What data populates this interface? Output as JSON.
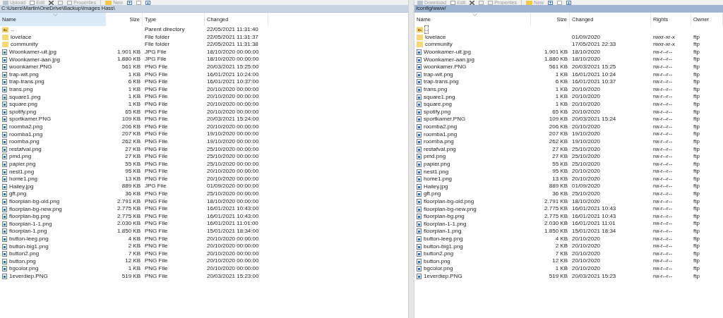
{
  "panes": [
    {
      "toolbar": [
        {
          "kind": "transfer",
          "label": "Upload"
        },
        {
          "kind": "edit",
          "label": "Edit"
        },
        {
          "kind": "delete"
        },
        {
          "kind": "rename"
        },
        {
          "kind": "properties",
          "label": "Properties"
        },
        {
          "kind": "new",
          "label": "New"
        },
        {
          "kind": "up"
        },
        {
          "kind": "blank"
        },
        {
          "kind": "down"
        }
      ],
      "active": false,
      "path": "C:\\Users\\Martin\\OneDrive\\Backup\\Images Hass\\",
      "columns": [
        {
          "label": "Name",
          "sorted": true,
          "highlighted": true
        },
        {
          "label": "Size",
          "sorted": false,
          "highlighted": false
        },
        {
          "label": "Type",
          "sorted": false,
          "highlighted": false
        },
        {
          "label": "Changed",
          "sorted": false,
          "highlighted": false
        }
      ],
      "rows": [
        {
          "kind": "parent",
          "focused": false,
          "cells": [
            "..",
            "",
            "Parent directory",
            "22/05/2021  11:31:40"
          ]
        },
        {
          "kind": "folder",
          "focused": false,
          "cells": [
            "lovelace",
            "",
            "File folder",
            "22/05/2021  11:31:37"
          ]
        },
        {
          "kind": "folder",
          "focused": false,
          "cells": [
            "community",
            "",
            "File folder",
            "22/05/2021  11:31:38"
          ]
        },
        {
          "kind": "file",
          "focused": false,
          "cells": [
            "Woonkamer-uit.jpg",
            "1.901 KB",
            "JPG File",
            "18/10/2020  00:00:00"
          ]
        },
        {
          "kind": "file",
          "focused": false,
          "cells": [
            "Woonkamer-aan.jpg",
            "1.880 KB",
            "JPG File",
            "18/10/2020  00:00:00"
          ]
        },
        {
          "kind": "file",
          "focused": false,
          "cells": [
            "woonkamer.PNG",
            "561 KB",
            "PNG File",
            "20/03/2021  15:25:00"
          ]
        },
        {
          "kind": "file",
          "focused": false,
          "cells": [
            "trap-wit.png",
            "1 KB",
            "PNG File",
            "16/01/2021  10:24:00"
          ]
        },
        {
          "kind": "file",
          "focused": false,
          "cells": [
            "trap-trans.png",
            "6 KB",
            "PNG File",
            "16/01/2021  10:37:00"
          ]
        },
        {
          "kind": "file",
          "focused": false,
          "cells": [
            "trans.png",
            "1 KB",
            "PNG File",
            "20/10/2020  00:00:00"
          ]
        },
        {
          "kind": "file",
          "focused": false,
          "cells": [
            "square1.png",
            "1 KB",
            "PNG File",
            "20/10/2020  00:00:00"
          ]
        },
        {
          "kind": "file",
          "focused": false,
          "cells": [
            "square.png",
            "1 KB",
            "PNG File",
            "20/10/2020  00:00:00"
          ]
        },
        {
          "kind": "file",
          "focused": false,
          "cells": [
            "spotify.png",
            "65 KB",
            "PNG File",
            "20/10/2020  00:00:00"
          ]
        },
        {
          "kind": "file",
          "focused": false,
          "cells": [
            "sportkamer.PNG",
            "109 KB",
            "PNG File",
            "20/03/2021  15:24:00"
          ]
        },
        {
          "kind": "file",
          "focused": false,
          "cells": [
            "roomba2.png",
            "206 KB",
            "PNG File",
            "20/10/2020  00:00:00"
          ]
        },
        {
          "kind": "file",
          "focused": false,
          "cells": [
            "roomba1.png",
            "207 KB",
            "PNG File",
            "19/10/2020  00:00:00"
          ]
        },
        {
          "kind": "file",
          "focused": false,
          "cells": [
            "roomba.png",
            "262 KB",
            "PNG File",
            "19/10/2020  00:00:00"
          ]
        },
        {
          "kind": "file",
          "focused": false,
          "cells": [
            "restafval.png",
            "27 KB",
            "PNG File",
            "25/10/2020  00:00:00"
          ]
        },
        {
          "kind": "file",
          "focused": false,
          "cells": [
            "pmd.png",
            "27 KB",
            "PNG File",
            "25/10/2020  00:00:00"
          ]
        },
        {
          "kind": "file",
          "focused": false,
          "cells": [
            "papier.png",
            "55 KB",
            "PNG File",
            "25/10/2020  00:00:00"
          ]
        },
        {
          "kind": "file",
          "focused": false,
          "cells": [
            "nest1.png",
            "95 KB",
            "PNG File",
            "20/10/2020  00:00:00"
          ]
        },
        {
          "kind": "file",
          "focused": false,
          "cells": [
            "home1.png",
            "13 KB",
            "PNG File",
            "20/10/2020  00:00:00"
          ]
        },
        {
          "kind": "file",
          "focused": false,
          "cells": [
            "Hailey.jpg",
            "889 KB",
            "JPG File",
            "01/09/2020  00:00:00"
          ]
        },
        {
          "kind": "file",
          "focused": false,
          "cells": [
            "gft.png",
            "36 KB",
            "PNG File",
            "25/10/2020  00:00:00"
          ]
        },
        {
          "kind": "file",
          "focused": false,
          "cells": [
            "floorplan-bg-old.png",
            "2.791 KB",
            "PNG File",
            "18/10/2020  00:00:00"
          ]
        },
        {
          "kind": "file",
          "focused": false,
          "cells": [
            "floorplan-bg-new.png",
            "2.775 KB",
            "PNG File",
            "16/01/2021  10:43:00"
          ]
        },
        {
          "kind": "file",
          "focused": false,
          "cells": [
            "floorplan-bg.png",
            "2.775 KB",
            "PNG File",
            "16/01/2021  10:43:00"
          ]
        },
        {
          "kind": "file",
          "focused": false,
          "cells": [
            "floorplan-1-1.png",
            "2.030 KB",
            "PNG File",
            "16/01/2021  11:01:00"
          ]
        },
        {
          "kind": "file",
          "focused": false,
          "cells": [
            "floorplan-1.png",
            "1.850 KB",
            "PNG File",
            "15/01/2021  18:34:00"
          ]
        },
        {
          "kind": "file",
          "focused": false,
          "cells": [
            "button-leeg.png",
            "4 KB",
            "PNG File",
            "20/10/2020  00:00:00"
          ]
        },
        {
          "kind": "file",
          "focused": false,
          "cells": [
            "button-big1.png",
            "2 KB",
            "PNG File",
            "20/10/2020  00:00:00"
          ]
        },
        {
          "kind": "file",
          "focused": false,
          "cells": [
            "button2.png",
            "7 KB",
            "PNG File",
            "20/10/2020  00:00:00"
          ]
        },
        {
          "kind": "file",
          "focused": false,
          "cells": [
            "button.png",
            "12 KB",
            "PNG File",
            "20/10/2020  00:00:00"
          ]
        },
        {
          "kind": "file",
          "focused": false,
          "cells": [
            "bgcolor.png",
            "1 KB",
            "PNG File",
            "20/10/2020  00:00:00"
          ]
        },
        {
          "kind": "file",
          "focused": false,
          "cells": [
            "1everdiep.PNG",
            "519 KB",
            "PNG File",
            "20/03/2021  15:23:00"
          ]
        }
      ]
    },
    {
      "toolbar": [
        {
          "kind": "transfer",
          "label": "Download"
        },
        {
          "kind": "edit",
          "label": "Edit"
        },
        {
          "kind": "delete"
        },
        {
          "kind": "rename"
        },
        {
          "kind": "properties",
          "label": "Properties"
        },
        {
          "kind": "new",
          "label": "New"
        },
        {
          "kind": "up"
        },
        {
          "kind": "blank"
        },
        {
          "kind": "down"
        }
      ],
      "active": true,
      "path": "/config/www/",
      "columns": [
        {
          "label": "Name",
          "sorted": true,
          "highlighted": false
        },
        {
          "label": "Size",
          "sorted": false,
          "highlighted": false
        },
        {
          "label": "Changed",
          "sorted": false,
          "highlighted": false
        },
        {
          "label": "Rights",
          "sorted": false,
          "highlighted": false
        },
        {
          "label": "Owner",
          "sorted": false,
          "highlighted": false
        }
      ],
      "rows": [
        {
          "kind": "parent",
          "focused": true,
          "cells": [
            "..",
            "",
            "",
            "",
            ""
          ]
        },
        {
          "kind": "folder",
          "focused": false,
          "cells": [
            "lovelace",
            "",
            "01/09/2020",
            "rwxr-xr-x",
            "ftp"
          ]
        },
        {
          "kind": "folder",
          "focused": false,
          "cells": [
            "community",
            "",
            "17/05/2021 22:33",
            "rwxr-xr-x",
            "ftp"
          ]
        },
        {
          "kind": "file",
          "focused": false,
          "cells": [
            "Woonkamer-uit.jpg",
            "1.901 KB",
            "18/10/2020",
            "rw-r--r--",
            "ftp"
          ]
        },
        {
          "kind": "file",
          "focused": false,
          "cells": [
            "Woonkamer-aan.jpg",
            "1.880 KB",
            "18/10/2020",
            "rw-r--r--",
            "ftp"
          ]
        },
        {
          "kind": "file",
          "focused": false,
          "cells": [
            "woonkamer.PNG",
            "561 KB",
            "20/03/2021 15:25",
            "rw-r--r--",
            "ftp"
          ]
        },
        {
          "kind": "file",
          "focused": false,
          "cells": [
            "trap-wit.png",
            "1 KB",
            "16/01/2021 10:24",
            "rw-r--r--",
            "ftp"
          ]
        },
        {
          "kind": "file",
          "focused": false,
          "cells": [
            "trap-trans.png",
            "6 KB",
            "16/01/2021 10:37",
            "rw-r--r--",
            "ftp"
          ]
        },
        {
          "kind": "file",
          "focused": false,
          "cells": [
            "trans.png",
            "1 KB",
            "20/10/2020",
            "rw-r--r--",
            "ftp"
          ]
        },
        {
          "kind": "file",
          "focused": false,
          "cells": [
            "square1.png",
            "1 KB",
            "20/10/2020",
            "rw-r--r--",
            "ftp"
          ]
        },
        {
          "kind": "file",
          "focused": false,
          "cells": [
            "square.png",
            "1 KB",
            "20/10/2020",
            "rw-r--r--",
            "ftp"
          ]
        },
        {
          "kind": "file",
          "focused": false,
          "cells": [
            "spotify.png",
            "65 KB",
            "20/10/2020",
            "rw-r--r--",
            "ftp"
          ]
        },
        {
          "kind": "file",
          "focused": false,
          "cells": [
            "sportkamer.PNG",
            "109 KB",
            "20/03/2021 15:24",
            "rw-r--r--",
            "ftp"
          ]
        },
        {
          "kind": "file",
          "focused": false,
          "cells": [
            "roomba2.png",
            "206 KB",
            "20/10/2020",
            "rw-r--r--",
            "ftp"
          ]
        },
        {
          "kind": "file",
          "focused": false,
          "cells": [
            "roomba1.png",
            "207 KB",
            "19/10/2020",
            "rw-r--r--",
            "ftp"
          ]
        },
        {
          "kind": "file",
          "focused": false,
          "cells": [
            "roomba.png",
            "262 KB",
            "19/10/2020",
            "rw-r--r--",
            "ftp"
          ]
        },
        {
          "kind": "file",
          "focused": false,
          "cells": [
            "restafval.png",
            "27 KB",
            "25/10/2020",
            "rw-r--r--",
            "ftp"
          ]
        },
        {
          "kind": "file",
          "focused": false,
          "cells": [
            "pmd.png",
            "27 KB",
            "25/10/2020",
            "rw-r--r--",
            "ftp"
          ]
        },
        {
          "kind": "file",
          "focused": false,
          "cells": [
            "papier.png",
            "55 KB",
            "25/10/2020",
            "rw-r--r--",
            "ftp"
          ]
        },
        {
          "kind": "file",
          "focused": false,
          "cells": [
            "nest1.png",
            "95 KB",
            "20/10/2020",
            "rw-r--r--",
            "ftp"
          ]
        },
        {
          "kind": "file",
          "focused": false,
          "cells": [
            "home1.png",
            "13 KB",
            "20/10/2020",
            "rw-r--r--",
            "ftp"
          ]
        },
        {
          "kind": "file",
          "focused": false,
          "cells": [
            "Hailey.jpg",
            "889 KB",
            "01/09/2020",
            "rw-r--r--",
            "ftp"
          ]
        },
        {
          "kind": "file",
          "focused": false,
          "cells": [
            "gft.png",
            "36 KB",
            "25/10/2020",
            "rw-r--r--",
            "ftp"
          ]
        },
        {
          "kind": "file",
          "focused": false,
          "cells": [
            "floorplan-bg-old.png",
            "2.791 KB",
            "18/10/2020",
            "rw-r--r--",
            "ftp"
          ]
        },
        {
          "kind": "file",
          "focused": false,
          "cells": [
            "floorplan-bg-new.png",
            "2.775 KB",
            "16/01/2021 10:43",
            "rw-r--r--",
            "ftp"
          ]
        },
        {
          "kind": "file",
          "focused": false,
          "cells": [
            "floorplan-bg.png",
            "2.775 KB",
            "16/01/2021 10:43",
            "rw-r--r--",
            "ftp"
          ]
        },
        {
          "kind": "file",
          "focused": false,
          "cells": [
            "floorplan-1-1.png",
            "2.030 KB",
            "16/01/2021 11:01",
            "rw-r--r--",
            "ftp"
          ]
        },
        {
          "kind": "file",
          "focused": false,
          "cells": [
            "floorplan-1.png",
            "1.850 KB",
            "15/01/2021 18:34",
            "rw-r--r--",
            "ftp"
          ]
        },
        {
          "kind": "file",
          "focused": false,
          "cells": [
            "button-leeg.png",
            "4 KB",
            "20/10/2020",
            "rw-r--r--",
            "ftp"
          ]
        },
        {
          "kind": "file",
          "focused": false,
          "cells": [
            "button-big1.png",
            "2 KB",
            "20/10/2020",
            "rw-r--r--",
            "ftp"
          ]
        },
        {
          "kind": "file",
          "focused": false,
          "cells": [
            "button2.png",
            "7 KB",
            "20/10/2020",
            "rw-r--r--",
            "ftp"
          ]
        },
        {
          "kind": "file",
          "focused": false,
          "cells": [
            "button.png",
            "12 KB",
            "20/10/2020",
            "rw-r--r--",
            "ftp"
          ]
        },
        {
          "kind": "file",
          "focused": false,
          "cells": [
            "bgcolor.png",
            "1 KB",
            "20/10/2020",
            "rw-r--r--",
            "ftp"
          ]
        },
        {
          "kind": "file",
          "focused": false,
          "cells": [
            "1everdiep.PNG",
            "519 KB",
            "20/03/2021 15:23",
            "rw-r--r--",
            "ftp"
          ]
        }
      ]
    }
  ]
}
